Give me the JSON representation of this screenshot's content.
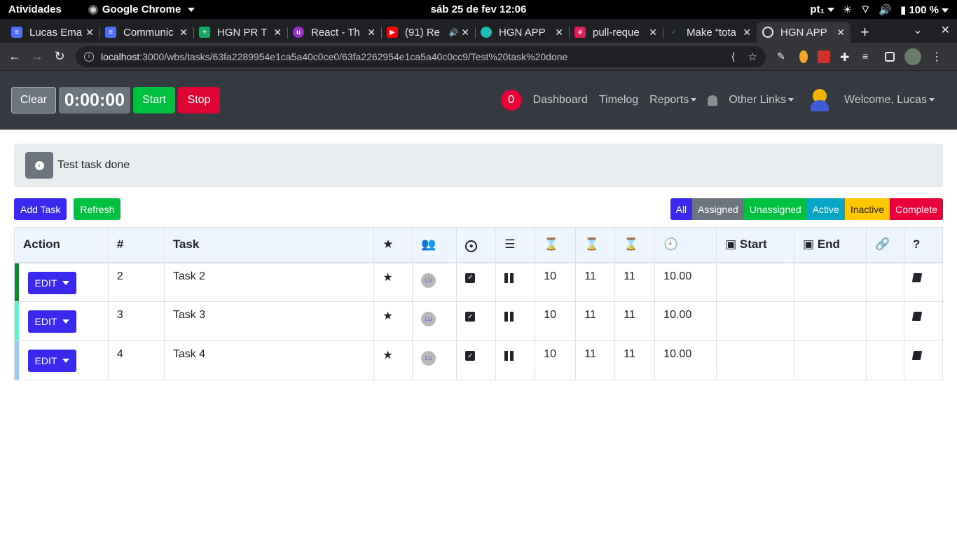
{
  "os_bar": {
    "activities": "Atividades",
    "app_name": "Google Chrome",
    "clock": "sáb 25 de fev  12:06",
    "keyboard": "pt₁",
    "battery": "100 %"
  },
  "tabs": [
    {
      "title": "Lucas Ema",
      "color": "#4f6ef7"
    },
    {
      "title": "Communic",
      "color": "#4f6ef7"
    },
    {
      "title": "HGN PR T",
      "color": "#16a765"
    },
    {
      "title": "React - Th",
      "color": "#9b2fd5"
    },
    {
      "title": "(91) Re",
      "color": "#ff0000"
    },
    {
      "title": "HGN APP",
      "color": "#1dbfb0"
    },
    {
      "title": "pull-reque",
      "color": "#e01e5a"
    },
    {
      "title": "Make “tota",
      "color": "#2f7d32"
    },
    {
      "title": "HGN APP",
      "color": "#9aa0a6"
    }
  ],
  "omnibox": {
    "host": "localhost",
    "path": ":3000/wbs/tasks/63fa2289954e1ca5a40c0ce0/63fa2262954e1ca5a40c0cc9/Test%20task%20done"
  },
  "header": {
    "clear": "Clear",
    "timer": "0:00:00",
    "start": "Start",
    "stop": "Stop",
    "badge": "0",
    "dashboard": "Dashboard",
    "timelog": "Timelog",
    "reports": "Reports",
    "other_links": "Other Links",
    "welcome": "Welcome, Lucas"
  },
  "breadcrumb": {
    "title": "Test task done"
  },
  "actions": {
    "add_task": "Add Task",
    "refresh": "Refresh"
  },
  "filters": {
    "all": "All",
    "assigned": "Assigned",
    "unassigned": "Unassigned",
    "active": "Active",
    "inactive": "Inactive",
    "complete": "Complete"
  },
  "table": {
    "headers": {
      "action": "Action",
      "num": "#",
      "task": "Task",
      "start": "Start",
      "end": "End",
      "help": "?"
    },
    "rows": [
      {
        "num": "2",
        "task": "Task 2",
        "initials": "LU",
        "c1": "10",
        "c2": "11",
        "c3": "11",
        "hours": "10.00",
        "stripe": "#0a8a2a",
        "edit": "EDIT"
      },
      {
        "num": "3",
        "task": "Task 3",
        "initials": "LU",
        "c1": "10",
        "c2": "11",
        "c3": "11",
        "hours": "10.00",
        "stripe": "#5ff0d0",
        "edit": "EDIT"
      },
      {
        "num": "4",
        "task": "Task 4",
        "initials": "LU",
        "c1": "10",
        "c2": "11",
        "c3": "11",
        "hours": "10.00",
        "stripe": "#9ccaf5",
        "edit": "EDIT"
      }
    ]
  }
}
